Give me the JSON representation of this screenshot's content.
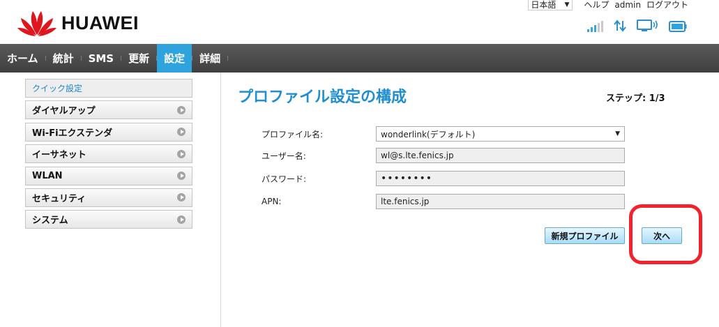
{
  "header": {
    "brand": "HUAWEI",
    "language": "日本語",
    "links": [
      "ヘルプ",
      "admin",
      "ログアウト"
    ]
  },
  "nav": {
    "items": [
      {
        "label": "ホーム",
        "active": false
      },
      {
        "label": "統計",
        "active": false
      },
      {
        "label": "SMS",
        "active": false
      },
      {
        "label": "更新",
        "active": false
      },
      {
        "label": "設定",
        "active": true
      },
      {
        "label": "詳細",
        "active": false
      }
    ]
  },
  "sidebar": {
    "items": [
      {
        "label": "クイック設定",
        "active": true
      },
      {
        "label": "ダイヤルアップ",
        "active": false
      },
      {
        "label": "Wi-Fiエクステンダ",
        "active": false
      },
      {
        "label": "イーサネット",
        "active": false
      },
      {
        "label": "WLAN",
        "active": false
      },
      {
        "label": "セキュリティ",
        "active": false
      },
      {
        "label": "システム",
        "active": false
      }
    ]
  },
  "main": {
    "title": "プロファイル設定の構成",
    "step": "ステップ: 1/3",
    "form": {
      "profile_label": "プロファイル名:",
      "profile_value": "wonderlink(デフォルト)",
      "user_label": "ユーザー名:",
      "user_value": "wl@s.lte.fenics.jp",
      "password_label": "パスワード:",
      "password_value": "••••••••",
      "apn_label": "APN:",
      "apn_value": "lte.fenics.jp"
    },
    "buttons": {
      "new_profile": "新規プロファイル",
      "next": "次へ"
    }
  },
  "colors": {
    "accent": "#2fa3de",
    "nav_bg": "#4a4a4a",
    "title": "#1f8fd1",
    "highlight": "#f2212b"
  }
}
